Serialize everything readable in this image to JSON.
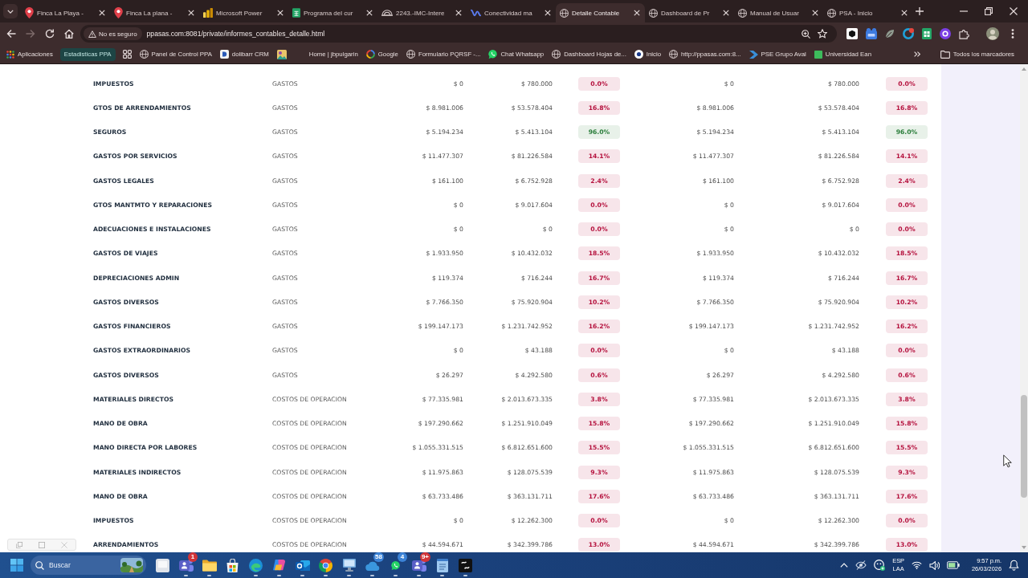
{
  "browser": {
    "tabs": [
      {
        "title": "Finca La Playa -",
        "kind": "pin",
        "selected": false
      },
      {
        "title": "Finca La plana -",
        "kind": "pin",
        "selected": false
      },
      {
        "title": "Microsoft Power",
        "kind": "bars",
        "selected": false
      },
      {
        "title": "Programa del cur",
        "kind": "sheet",
        "selected": false
      },
      {
        "title": "2243.-IMC-Intere",
        "kind": "dome",
        "selected": false
      },
      {
        "title": "Conectividad ma",
        "kind": "wave",
        "selected": false
      },
      {
        "title": "Detalle Contable",
        "kind": "globe",
        "selected": true
      },
      {
        "title": "Dashboard de Pr",
        "kind": "globe",
        "selected": false
      },
      {
        "title": "Manual de Usuar",
        "kind": "globe",
        "selected": false
      },
      {
        "title": "PSA - Inicio",
        "kind": "globe",
        "selected": false
      }
    ],
    "address_bar": {
      "security": "No es seguro",
      "url": "ppasas.com:8081/private/informes_contables_detalle.html"
    },
    "bookmarks": [
      {
        "label": "Aplicaciones",
        "kind": "apps"
      },
      {
        "label": "Estadisticas PPA",
        "kind": "group"
      },
      {
        "kind": "grid"
      },
      {
        "label": "Panel de Control PPA",
        "kind": "globe"
      },
      {
        "label": "dolibarr CRM",
        "kind": "tile"
      },
      {
        "kind": "picture"
      },
      {
        "label": "Home | jbpulgarin",
        "kind": "blank"
      },
      {
        "label": "Google",
        "kind": "ring"
      },
      {
        "label": "Formulario PQRSF -...",
        "kind": "globe"
      },
      {
        "label": "Chat Whatsapp",
        "kind": "chat"
      },
      {
        "label": "Dashboard Hojas de...",
        "kind": "globe"
      },
      {
        "label": "Inicio",
        "kind": "dot"
      },
      {
        "label": "http://ppasas.com:8...",
        "kind": "globe"
      },
      {
        "label": "PSE Grupo Aval",
        "kind": "arrow"
      },
      {
        "label": "Universidad Ean",
        "kind": "square"
      }
    ],
    "all_bookmarks": "Todos los marcadores"
  },
  "table": {
    "rows": [
      {
        "cells": [
          "IMPUESTOS",
          "GASTOS",
          "$ 0",
          "$ 780.000",
          "0.0%",
          "$ 0",
          "$ 780.000",
          "0.0%"
        ],
        "color": "#b5123e"
      },
      {
        "cells": [
          "GTOS DE ARRENDAMIENTOS",
          "GASTOS",
          "$ 8.981.006",
          "$ 53.578.404",
          "16.8%",
          "$ 8.981.006",
          "$ 53.578.404",
          "16.8%"
        ],
        "color": "#b5123e"
      },
      {
        "cells": [
          "SEGUROS",
          "GASTOS",
          "$ 5.194.234",
          "$ 5.413.104",
          "96.0%",
          "$ 5.194.234",
          "$ 5.413.104",
          "96.0%"
        ],
        "color": "#2a7d3a"
      },
      {
        "cells": [
          "GASTOS POR SERVICIOS",
          "GASTOS",
          "$ 11.477.307",
          "$ 81.226.584",
          "14.1%",
          "$ 11.477.307",
          "$ 81.226.584",
          "14.1%"
        ],
        "color": "#b5123e"
      },
      {
        "cells": [
          "GASTOS LEGALES",
          "GASTOS",
          "$ 161.100",
          "$ 6.752.928",
          "2.4%",
          "$ 161.100",
          "$ 6.752.928",
          "2.4%"
        ],
        "color": "#b5123e"
      },
      {
        "cells": [
          "GTOS MANTMTO Y REPARACIONES",
          "GASTOS",
          "$ 0",
          "$ 9.017.604",
          "0.0%",
          "$ 0",
          "$ 9.017.604",
          "0.0%"
        ],
        "color": "#b5123e"
      },
      {
        "cells": [
          "ADECUACIONES E INSTALACIONES",
          "GASTOS",
          "$ 0",
          "$ 0",
          "0.0%",
          "$ 0",
          "$ 0",
          "0.0%"
        ],
        "color": "#b5123e"
      },
      {
        "cells": [
          "GASTOS DE VIAJES",
          "GASTOS",
          "$ 1.933.950",
          "$ 10.432.032",
          "18.5%",
          "$ 1.933.950",
          "$ 10.432.032",
          "18.5%"
        ],
        "color": "#b5123e"
      },
      {
        "cells": [
          "DEPRECIACIONES ADMIN",
          "GASTOS",
          "$ 119.374",
          "$ 716.244",
          "16.7%",
          "$ 119.374",
          "$ 716.244",
          "16.7%"
        ],
        "color": "#b5123e"
      },
      {
        "cells": [
          "GASTOS DIVERSOS",
          "GASTOS",
          "$ 7.766.350",
          "$ 75.920.904",
          "10.2%",
          "$ 7.766.350",
          "$ 75.920.904",
          "10.2%"
        ],
        "color": "#b5123e"
      },
      {
        "cells": [
          "GASTOS FINANCIEROS",
          "GASTOS",
          "$ 199.147.173",
          "$ 1.231.742.952",
          "16.2%",
          "$ 199.147.173",
          "$ 1.231.742.952",
          "16.2%"
        ],
        "color": "#b5123e"
      },
      {
        "cells": [
          "GASTOS EXTRAORDINARIOS",
          "GASTOS",
          "$ 0",
          "$ 43.188",
          "0.0%",
          "$ 0",
          "$ 43.188",
          "0.0%"
        ],
        "color": "#b5123e"
      },
      {
        "cells": [
          "GASTOS DIVERSOS",
          "GASTOS",
          "$ 26.297",
          "$ 4.292.580",
          "0.6%",
          "$ 26.297",
          "$ 4.292.580",
          "0.6%"
        ],
        "color": "#b5123e"
      },
      {
        "cells": [
          "MATERIALES DIRECTOS",
          "COSTOS DE OPERACION",
          "$ 77.335.981",
          "$ 2.013.673.335",
          "3.8%",
          "$ 77.335.981",
          "$ 2.013.673.335",
          "3.8%"
        ],
        "color": "#b5123e"
      },
      {
        "cells": [
          "MANO DE OBRA",
          "COSTOS DE OPERACION",
          "$ 197.290.662",
          "$ 1.251.910.049",
          "15.8%",
          "$ 197.290.662",
          "$ 1.251.910.049",
          "15.8%"
        ],
        "color": "#b5123e"
      },
      {
        "cells": [
          "MANO DIRECTA POR LABORES",
          "COSTOS DE OPERACION",
          "$ 1.055.331.515",
          "$ 6.812.651.600",
          "15.5%",
          "$ 1.055.331.515",
          "$ 6.812.651.600",
          "15.5%"
        ],
        "color": "#b5123e"
      },
      {
        "cells": [
          "MATERIALES INDIRECTOS",
          "COSTOS DE OPERACION",
          "$ 11.975.863",
          "$ 128.075.539",
          "9.3%",
          "$ 11.975.863",
          "$ 128.075.539",
          "9.3%"
        ],
        "color": "#b5123e"
      },
      {
        "cells": [
          "MANO DE OBRA",
          "COSTOS DE OPERACION",
          "$ 63.733.486",
          "$ 363.131.711",
          "17.6%",
          "$ 63.733.486",
          "$ 363.131.711",
          "17.6%"
        ],
        "color": "#b5123e"
      },
      {
        "cells": [
          "IMPUESTOS",
          "COSTOS DE OPERACION",
          "$ 0",
          "$ 12.262.300",
          "0.0%",
          "$ 0",
          "$ 12.262.300",
          "0.0%"
        ],
        "color": "#b5123e"
      },
      {
        "cells": [
          "ARRENDAMIENTOS",
          "COSTOS DE OPERACION",
          "$ 44.594.671",
          "$ 342.399.786",
          "13.0%",
          "$ 44.594.671",
          "$ 342.399.786",
          "13.0%"
        ],
        "color": "#b5123e"
      }
    ]
  },
  "taskbar": {
    "search": {
      "placeholder": "Buscar"
    },
    "apps": [
      {
        "kind": "tile",
        "running": false
      },
      {
        "kind": "people",
        "running": true,
        "badge": {
          "text": "1",
          "color": "#d13438"
        }
      },
      {
        "kind": "folder",
        "running": true
      },
      {
        "kind": "bag",
        "running": false
      },
      {
        "kind": "swirl",
        "running": true
      },
      {
        "kind": "petals",
        "running": true
      },
      {
        "kind": "mail",
        "running": true
      },
      {
        "kind": "browser",
        "running": true
      },
      {
        "kind": "computer",
        "running": true
      },
      {
        "kind": "cloud",
        "running": true,
        "badge": {
          "text": "58",
          "color": "#3b82d6"
        }
      },
      {
        "kind": "chat",
        "running": true,
        "badge": {
          "text": "4",
          "color": "#3b82d6"
        }
      },
      {
        "kind": "people",
        "running": true,
        "badge": {
          "text": "9+",
          "color": "#d13438"
        }
      },
      {
        "kind": "notepad",
        "running": true
      },
      {
        "kind": "logo",
        "running": true
      }
    ],
    "tray": {
      "language": "ESP",
      "layout": "LAA",
      "time": "9:57 p.m.",
      "date": "26/03/2026"
    }
  }
}
